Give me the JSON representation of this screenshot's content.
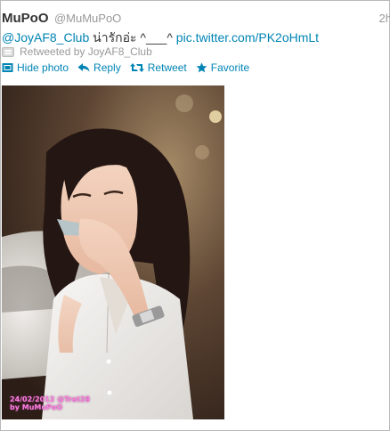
{
  "tweet": {
    "display_name": "MuPoO",
    "username": "@MuMuPoO",
    "time": "2h",
    "text": {
      "mention": "@JoyAF8_Club",
      "body": " น่ารักอ่ะ ^___^ ",
      "link": "pic.twitter.com/PK2oHmLt"
    },
    "retweeted_by": "Retweeted by JoyAF8_Club",
    "actions": {
      "hide_photo": "Hide photo",
      "reply": "Reply",
      "retweet": "Retweet",
      "favorite": "Favorite"
    },
    "photo": {
      "caption_line1": "24/02/2012 @Trat28",
      "caption_line2": "by MuMuPoO"
    }
  },
  "colors": {
    "link": "#0084b4",
    "muted": "#999999",
    "text": "#333333"
  },
  "icons": {
    "retweeted_by": "retweet-box-icon",
    "hide_photo": "photo-icon",
    "reply": "reply-arrow-icon",
    "retweet": "retweet-icon",
    "favorite": "star-icon"
  }
}
